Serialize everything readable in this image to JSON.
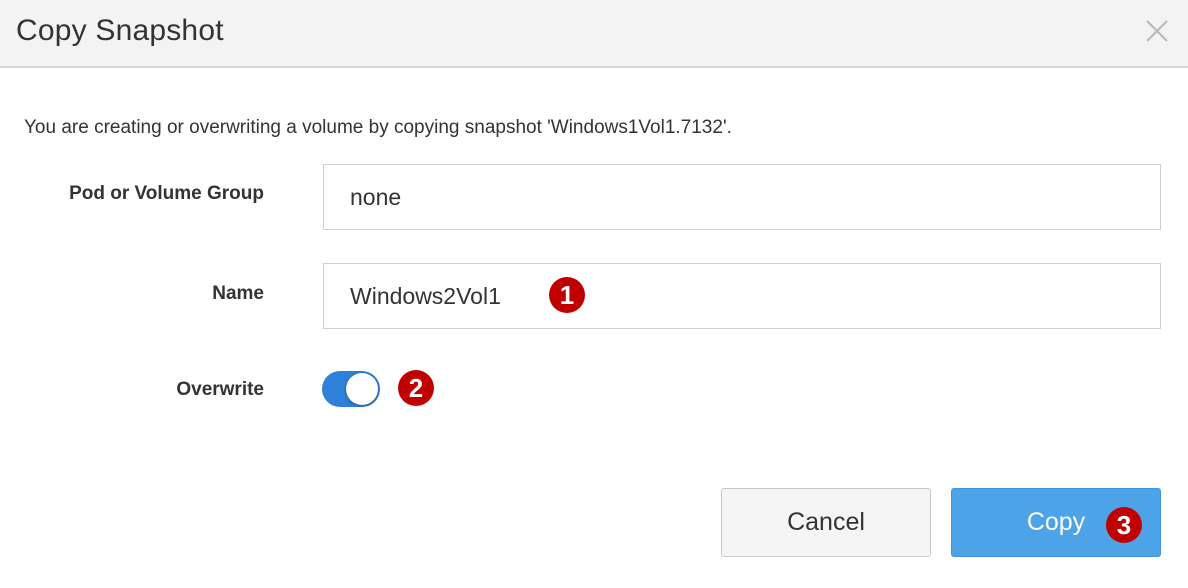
{
  "dialog": {
    "title": "Copy Snapshot",
    "message": "You are creating or overwriting a volume by copying snapshot 'Windows1Vol1.7132'."
  },
  "form": {
    "pod_label": "Pod or Volume Group",
    "pod_value": "none",
    "name_label": "Name",
    "name_value": "Windows2Vol1",
    "overwrite_label": "Overwrite",
    "overwrite_on": true
  },
  "buttons": {
    "cancel": "Cancel",
    "copy": "Copy"
  },
  "annotations": {
    "step1": "1",
    "step2": "2",
    "step3": "3"
  },
  "colors": {
    "toggle_on": "#2f80d8",
    "primary_button": "#4da3e8",
    "annotation_badge": "#c00000",
    "header_bg": "#f3f3f3"
  },
  "icons": {
    "close": "close-icon"
  }
}
